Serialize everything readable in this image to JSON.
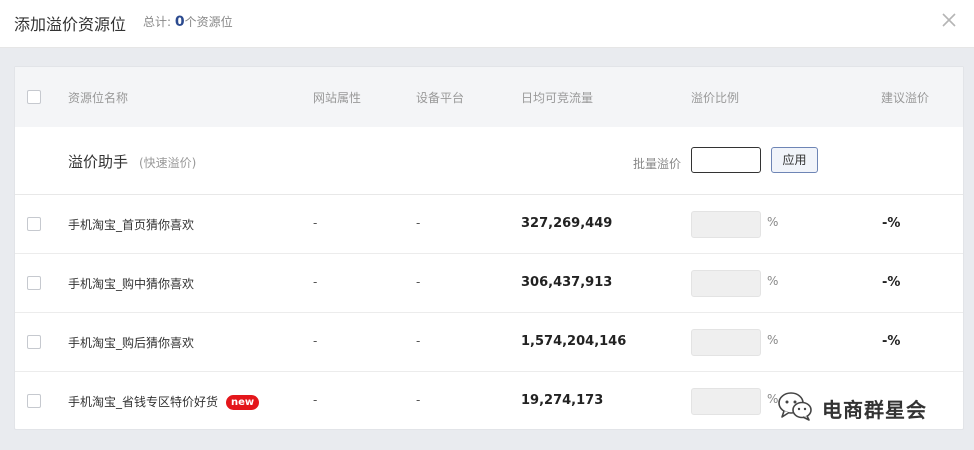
{
  "header": {
    "title": "添加溢价资源位",
    "total_prefix": "总计:",
    "total_count": "0",
    "total_suffix": "个资源位"
  },
  "table": {
    "columns": [
      "资源位名称",
      "网站属性",
      "设备平台",
      "日均可竞流量",
      "溢价比例",
      "建议溢价"
    ]
  },
  "helper": {
    "title": "溢价助手",
    "subtitle": "(快速溢价)",
    "bulk_label": "批量溢价",
    "bulk_value": "",
    "apply_label": "应用"
  },
  "rows": [
    {
      "name": "手机淘宝_首页猜你喜欢",
      "site": "-",
      "platform": "-",
      "traffic": "327,269,449",
      "ratio": "",
      "unit": "%",
      "suggest": "-%"
    },
    {
      "name": "手机淘宝_购中猜你喜欢",
      "site": "-",
      "platform": "-",
      "traffic": "306,437,913",
      "ratio": "",
      "unit": "%",
      "suggest": "-%"
    },
    {
      "name": "手机淘宝_购后猜你喜欢",
      "site": "-",
      "platform": "-",
      "traffic": "1,574,204,146",
      "ratio": "",
      "unit": "%",
      "suggest": "-%"
    },
    {
      "name": "手机淘宝_省钱专区特价好货",
      "badge": "new",
      "site": "-",
      "platform": "-",
      "traffic": "19,274,173",
      "ratio": "",
      "unit": "%",
      "suggest": ""
    }
  ],
  "watermark": {
    "text": "电商群星会",
    "icon": "wechat-icon"
  }
}
